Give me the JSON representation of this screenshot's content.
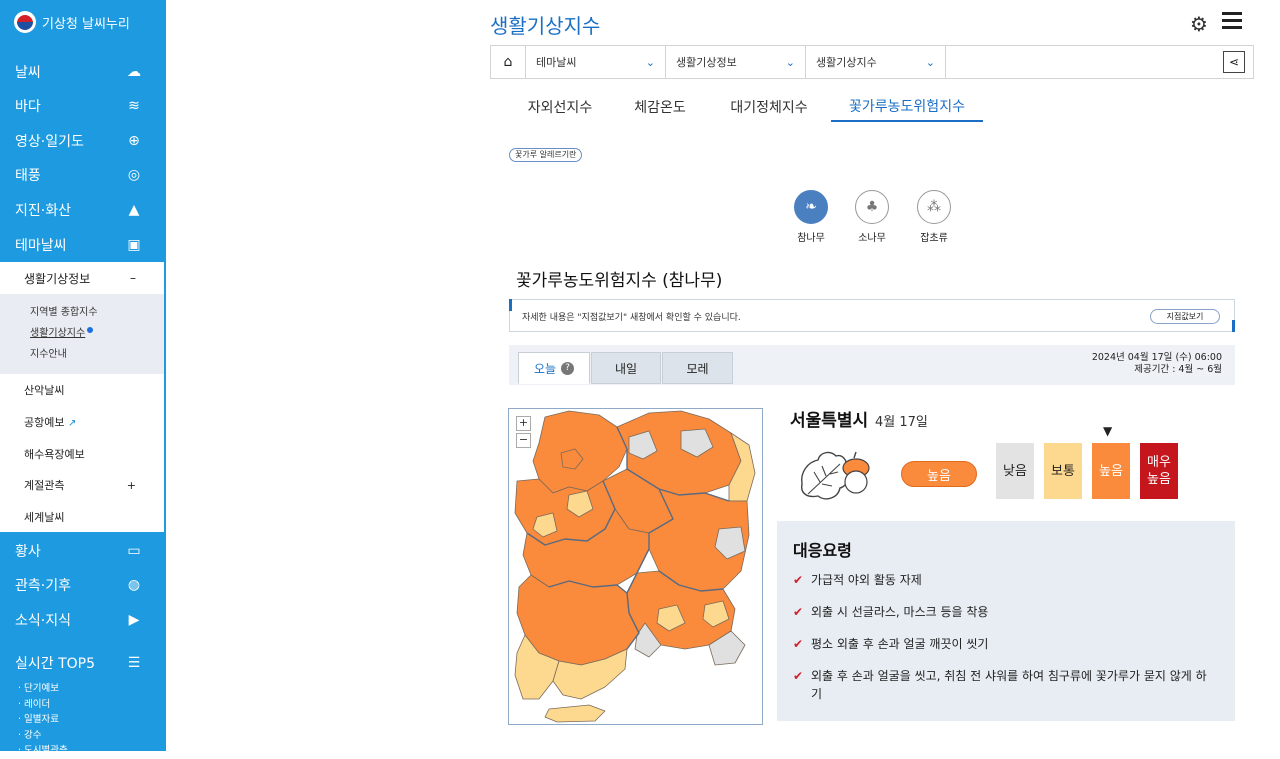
{
  "logo": {
    "text": "기상청 날씨누리"
  },
  "nav": [
    {
      "label": "날씨",
      "icon": "cloud-sun-icon"
    },
    {
      "label": "바다",
      "icon": "wave-icon"
    },
    {
      "label": "영상·일기도",
      "icon": "globe-icon"
    },
    {
      "label": "태풍",
      "icon": "typhoon-icon"
    },
    {
      "label": "지진·화산",
      "icon": "volcano-icon"
    },
    {
      "label": "테마날씨",
      "icon": "bag-icon"
    }
  ],
  "subpanel": {
    "head": "생활기상정보",
    "head_toggle": "–",
    "items": [
      "지역별 종합지수",
      "생활기상지수",
      "지수안내"
    ],
    "other": [
      {
        "label": "산악날씨",
        "mark": ""
      },
      {
        "label": "공항예보",
        "mark": "external-link-icon"
      },
      {
        "label": "해수욕장예보",
        "mark": ""
      },
      {
        "label": "계절관측",
        "mark": "+"
      },
      {
        "label": "세계날씨",
        "mark": ""
      }
    ]
  },
  "nav2": [
    {
      "label": "황사",
      "icon": "dust-icon"
    },
    {
      "label": "관측·기후",
      "icon": "earth-icon"
    },
    {
      "label": "소식·지식",
      "icon": "play-icon"
    },
    {
      "label": "실시간 TOP5",
      "icon": "list-icon"
    }
  ],
  "top5": [
    "단기예보",
    "레이더",
    "일별자료",
    "강수",
    "도시별관측"
  ],
  "page": {
    "title": "생활기상지수"
  },
  "breadcrumb": [
    "테마날씨",
    "생활기상정보",
    "생활기상지수"
  ],
  "tabs": [
    "자외선지수",
    "체감온도",
    "대기정체지수",
    "꽃가루농도위험지수"
  ],
  "badge": "꽃가루 알레르기란",
  "species": [
    "참나무",
    "소나무",
    "잡초류"
  ],
  "section_title": "꽃가루농도위험지수 (참나무)",
  "notice": {
    "text": "자세한 내용은 \"지점값보기\" 새창에서 확인할 수 있습니다.",
    "button": "지점값보기"
  },
  "day_tabs": [
    "오늘",
    "내일",
    "모레"
  ],
  "help": "?",
  "meta": {
    "date": "2024년 04월 17일 (수) 06:00",
    "period": "제공기간 : 4월 ~ 6월"
  },
  "zoom": {
    "in": "+",
    "out": "−"
  },
  "city": {
    "name": "서울특별시",
    "date": "4월 17일",
    "level": "높음"
  },
  "levels": [
    "낮음",
    "보통",
    "높음",
    "매우\n높음"
  ],
  "level_colors": [
    "#e3e3e3",
    "#fdd98f",
    "#fa8a3c",
    "#c4161c"
  ],
  "level_marker": "▼",
  "response": {
    "title": "대응요령",
    "items": [
      "가급적 야외 활동 자제",
      "외출 시 선글라스, 마스크 등을 착용",
      "평소 외출 후 손과 얼굴 깨끗이 씻기",
      "외출 후 손과 얼굴을 씻고, 취침 전 샤워를 하여 침구류에 꽃가루가 묻지 않게 하기"
    ]
  },
  "map_colors": {
    "high": "#fa8a3c",
    "normal": "#fdd98f",
    "low": "#e0e0e0"
  }
}
